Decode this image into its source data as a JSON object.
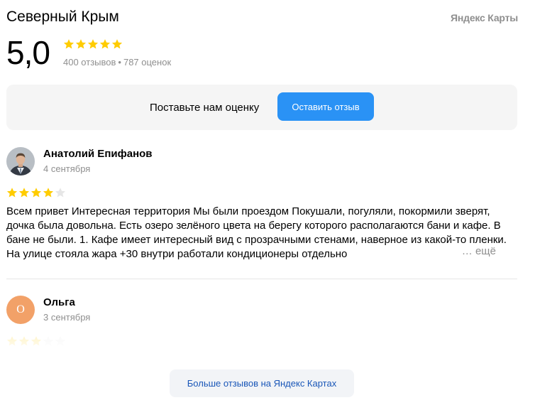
{
  "header": {
    "title": "Северный Крым",
    "brand": "Яндекс Карты"
  },
  "rating": {
    "value": "5,0",
    "stars": 5,
    "reviews_count": "400 отзывов",
    "separator": "•",
    "ratings_count": "787 оценок"
  },
  "cta": {
    "text": "Поставьте нам оценку",
    "button_label": "Оставить отзыв"
  },
  "reviews": [
    {
      "author": "Анатолий Епифанов",
      "date": "4 сентября",
      "rating": 4,
      "text": "Всем привет Интересная территория Мы были проездом Покушали, погуляли, покормили зверят, дочка была довольна. Есть озеро зелёного цвета на берегу которого располагаются бани и кафе. В бане не были. 1. Кафе имеет интересный вид с прозрачными стенами, наверное из какой-то пленки. На улице стояла жара +30 внутри работали кондиционеры отдельно",
      "more_label": "… ещё"
    },
    {
      "author": "Ольга",
      "avatar_letter": "О",
      "date": "3 сентября",
      "rating": 3
    }
  ],
  "footer": {
    "more_reviews_label": "Больше отзывов на Яндекс Картах"
  },
  "colors": {
    "star_filled": "#fc0",
    "star_empty": "#e6e6e6",
    "accent": "#2a92f5",
    "link": "#1a57b8",
    "avatar_bg": "#f2a168"
  },
  "icons": {
    "star": "star-icon",
    "avatar_photo": "user-photo-icon"
  }
}
